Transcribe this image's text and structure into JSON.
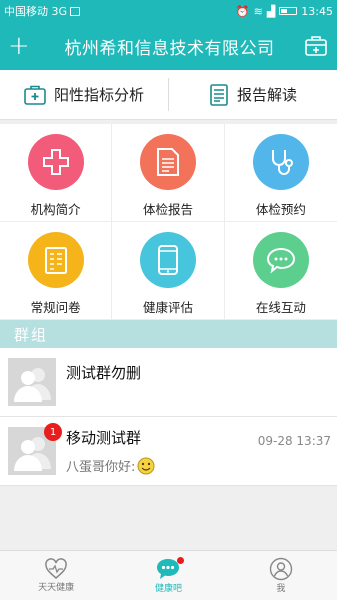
{
  "status_bar": {
    "carrier": "中国移动 3G",
    "time": "13:45"
  },
  "app_bar": {
    "title": "杭州希和信息技术有限公司",
    "add_icon": "plus-icon",
    "right_icon": "medical-kit-icon"
  },
  "top_nav": [
    {
      "label": "阳性指标分析",
      "icon": "medical-case-icon"
    },
    {
      "label": "报告解读",
      "icon": "report-document-icon"
    }
  ],
  "features": [
    {
      "label": "机构简介",
      "color": "#f25c7a",
      "icon": "cross-icon"
    },
    {
      "label": "体检报告",
      "color": "#f2735a",
      "icon": "document-icon"
    },
    {
      "label": "体检预约",
      "color": "#52b6ea",
      "icon": "stethoscope-icon"
    },
    {
      "label": "常规问卷",
      "color": "#f6b41b",
      "icon": "questionnaire-icon"
    },
    {
      "label": "健康评估",
      "color": "#47c5dc",
      "icon": "phone-icon"
    },
    {
      "label": "在线互动",
      "color": "#5ccf8e",
      "icon": "chat-bubble-icon"
    }
  ],
  "groups_section": {
    "title": "群组",
    "items": [
      {
        "name": "测试群勿删",
        "last_message": "",
        "time": "",
        "badge": ""
      },
      {
        "name": "移动测试群",
        "last_message": "八蛋哥你好:",
        "time": "09-28 13:37",
        "badge": "1"
      }
    ]
  },
  "tab_bar": [
    {
      "label": "天天健康",
      "icon": "heart-pulse-icon",
      "active": false
    },
    {
      "label": "健康吧",
      "icon": "chat-icon",
      "active": true
    },
    {
      "label": "我",
      "icon": "user-icon",
      "active": false
    }
  ]
}
